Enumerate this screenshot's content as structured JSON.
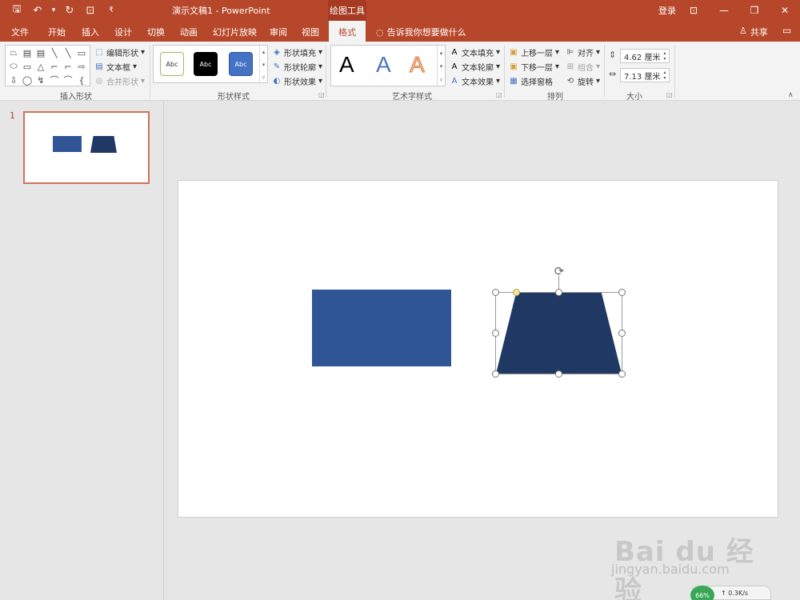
{
  "titlebar": {
    "qat": {
      "save": "🖫",
      "undo": "↶",
      "undo_drop": "▾",
      "redo": "↻",
      "start": "⊡",
      "customize": "₹"
    },
    "doc_title": "演示文稿1  -  PowerPoint",
    "context_tab_title": "绘图工具",
    "login": "登录",
    "win_ribbon": "⊡",
    "win_min": "—",
    "win_restore": "❐",
    "win_close": "✕"
  },
  "tabs": {
    "file": "文件",
    "home": "开始",
    "insert": "插入",
    "design": "设计",
    "transitions": "切换",
    "animations": "动画",
    "slideshow": "幻灯片放映",
    "review": "审阅",
    "view": "视图",
    "format": "格式",
    "tellme": "告诉我你想要做什么",
    "share": "共享",
    "comment_icon": "▭"
  },
  "ribbon": {
    "insert_shapes": {
      "label": "插入形状",
      "shapes": [
        "⏢",
        "▤",
        "▤",
        "╲",
        "╲",
        "▭",
        "⬭",
        "▭",
        "△",
        "⌐",
        "⌐",
        "⇨",
        "⇩",
        "◯",
        "↯",
        "⌒",
        "⌒",
        "{"
      ],
      "edit_shape": "编辑形状",
      "text_box": "文本框",
      "merge_shapes": "合并形状"
    },
    "shape_styles": {
      "label": "形状样式",
      "styles": [
        "Abc",
        "Abc",
        "Abc"
      ],
      "fill": "形状填充",
      "outline": "形状轮廓",
      "effects": "形状效果"
    },
    "wordart_styles": {
      "label": "艺术字样式",
      "letters": [
        "A",
        "A",
        "A"
      ],
      "text_fill": "文本填充",
      "text_outline": "文本轮廓",
      "text_effects": "文本效果"
    },
    "arrange": {
      "label": "排列",
      "bring_forward": "上移一层",
      "send_backward": "下移一层",
      "selection_pane": "选择窗格",
      "align": "对齐",
      "group": "组合",
      "rotate": "旋转"
    },
    "size": {
      "label": "大小",
      "height": "4.62 厘米",
      "width": "7.13 厘米"
    }
  },
  "thumbnails": {
    "slide_number": "1"
  },
  "watermark": {
    "brand": "Bai du 经验",
    "url": "jingyan.baidu.com"
  },
  "netwidget": {
    "percent": "66%",
    "speed": "↑ 0.3K/s"
  },
  "colors": {
    "accent": "#b7472a",
    "rect_fill": "#2f5597",
    "trap_fill": "#203864"
  }
}
